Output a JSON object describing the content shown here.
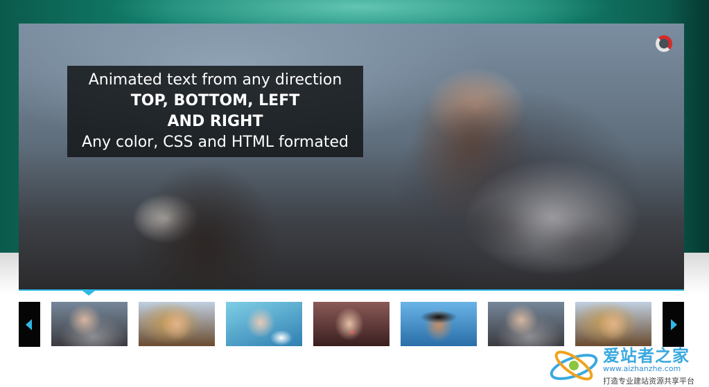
{
  "slider": {
    "caption": {
      "line1": "Animated text from any direction",
      "line2": "TOP, BOTTOM, LEFT",
      "line3": "AND RIGHT",
      "line4": "Any color, CSS and HTML formated"
    },
    "accent_color": "#2fb8e6",
    "timer_color": "#d62a2a",
    "active_thumbnail": 1,
    "thumbnails": [
      {
        "subject": "woman in fur coat"
      },
      {
        "subject": "smiling blonde woman"
      },
      {
        "subject": "woman in blue water"
      },
      {
        "subject": "woman with red lips"
      },
      {
        "subject": "woman with sunglasses"
      },
      {
        "subject": "woman in fur coat"
      },
      {
        "subject": "smiling blonde woman"
      }
    ],
    "icons": {
      "prev": "arrow-left-icon",
      "next": "arrow-right-icon",
      "timer": "loading-ring-icon"
    }
  },
  "watermark": {
    "title": "爱站者之家",
    "url": "www.aizhanzhe.com",
    "slogan": "打造专业建站资源共享平台"
  }
}
